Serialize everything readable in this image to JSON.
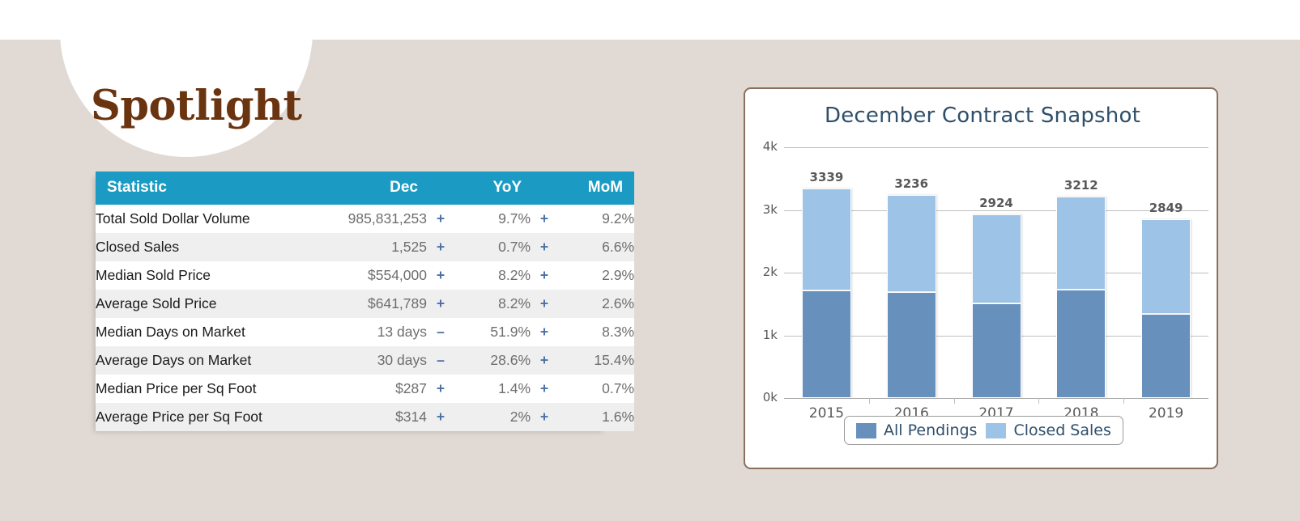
{
  "page": {
    "background_color": "#E1DAD4",
    "top_band_color": "#FFFFFF"
  },
  "spotlight": {
    "title": "Spotlight",
    "title_color": "#6B3410"
  },
  "table": {
    "header_color": "#1B9BC4",
    "columns": [
      "Statistic",
      "Dec",
      "YoY",
      "MoM"
    ],
    "rows": [
      {
        "label": "Total Sold Dollar Volume",
        "dec": "985,831,253",
        "yoy_sign": "+",
        "yoy": "9.7%",
        "mom_sign": "+",
        "mom": "9.2%"
      },
      {
        "label": "Closed Sales",
        "dec": "1,525",
        "yoy_sign": "+",
        "yoy": "0.7%",
        "mom_sign": "+",
        "mom": "6.6%"
      },
      {
        "label": "Median Sold Price",
        "dec": "$554,000",
        "yoy_sign": "+",
        "yoy": "8.2%",
        "mom_sign": "+",
        "mom": "2.9%"
      },
      {
        "label": "Average Sold Price",
        "dec": "$641,789",
        "yoy_sign": "+",
        "yoy": "8.2%",
        "mom_sign": "+",
        "mom": "2.6%"
      },
      {
        "label": "Median Days on Market",
        "dec": "13 days",
        "yoy_sign": "–",
        "yoy": "51.9%",
        "mom_sign": "+",
        "mom": "8.3%"
      },
      {
        "label": "Average Days on Market",
        "dec": "30 days",
        "yoy_sign": "–",
        "yoy": "28.6%",
        "mom_sign": "+",
        "mom": "15.4%"
      },
      {
        "label": "Median Price per Sq Foot",
        "dec": "$287",
        "yoy_sign": "+",
        "yoy": "1.4%",
        "mom_sign": "+",
        "mom": "0.7%"
      },
      {
        "label": "Average Price per Sq Foot",
        "dec": "$314",
        "yoy_sign": "+",
        "yoy": "2%",
        "mom_sign": "+",
        "mom": "1.6%"
      }
    ]
  },
  "chart_data": {
    "type": "bar",
    "stacked": true,
    "title": "December Contract Snapshot",
    "xlabel": "",
    "ylabel": "",
    "categories": [
      "2015",
      "2016",
      "2017",
      "2018",
      "2019"
    ],
    "series": [
      {
        "name": "All Pendings",
        "color": "#6890BC",
        "values": [
          1716,
          1690,
          1510,
          1729,
          1342
        ]
      },
      {
        "name": "Closed Sales",
        "color": "#9DC3E6",
        "values": [
          1623,
          1546,
          1414,
          1483,
          1507
        ]
      }
    ],
    "totals": [
      3339,
      3236,
      2924,
      3212,
      2849
    ],
    "bar_labels": [
      "3339",
      "3236",
      "2924",
      "3212",
      "2849"
    ],
    "ylim": [
      0,
      4000
    ],
    "yticks": [
      0,
      1000,
      2000,
      3000,
      4000
    ],
    "ytick_labels": [
      "0k",
      "1k",
      "2k",
      "3k",
      "4k"
    ],
    "grid": true,
    "legend_position": "bottom",
    "legend": [
      "All Pendings",
      "Closed Sales"
    ]
  }
}
